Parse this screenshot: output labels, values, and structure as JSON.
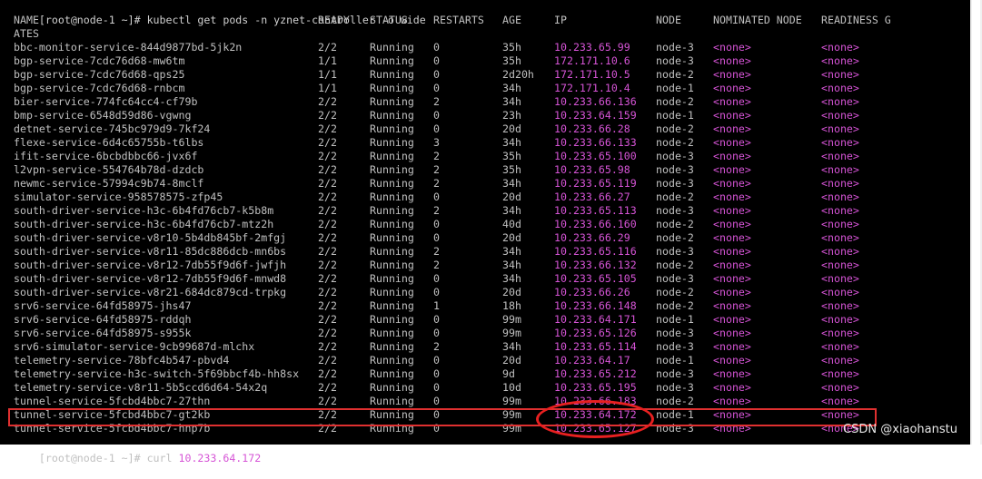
{
  "terminal": {
    "prompt_line": "[root@node-1 ~]# kubectl get pods -n yznet-controller -o wide",
    "headers": {
      "name": "NAME",
      "ready": "READY",
      "status": "STATUS",
      "restarts": "RESTARTS",
      "age": "AGE",
      "ip": "IP",
      "node": "NODE",
      "nominated_node": "NOMINATED NODE",
      "readiness_gates": "READINESS G",
      "wrap": "ATES"
    },
    "rows": [
      {
        "name": "bbc-monitor-service-844d9877bd-5jk2n",
        "ready": "2/2",
        "status": "Running",
        "restarts": "0",
        "age": "35h",
        "ip": "10.233.65.99",
        "node": "node-3",
        "nominated": "<none>",
        "gates": "<none>"
      },
      {
        "name": "bgp-service-7cdc76d68-mw6tm",
        "ready": "1/1",
        "status": "Running",
        "restarts": "0",
        "age": "35h",
        "ip": "172.171.10.6",
        "node": "node-3",
        "nominated": "<none>",
        "gates": "<none>"
      },
      {
        "name": "bgp-service-7cdc76d68-qps25",
        "ready": "1/1",
        "status": "Running",
        "restarts": "0",
        "age": "2d20h",
        "ip": "172.171.10.5",
        "node": "node-2",
        "nominated": "<none>",
        "gates": "<none>"
      },
      {
        "name": "bgp-service-7cdc76d68-rnbcm",
        "ready": "1/1",
        "status": "Running",
        "restarts": "0",
        "age": "34h",
        "ip": "172.171.10.4",
        "node": "node-1",
        "nominated": "<none>",
        "gates": "<none>"
      },
      {
        "name": "bier-service-774fc64cc4-cf79b",
        "ready": "2/2",
        "status": "Running",
        "restarts": "2",
        "age": "34h",
        "ip": "10.233.66.136",
        "node": "node-2",
        "nominated": "<none>",
        "gates": "<none>"
      },
      {
        "name": "bmp-service-6548d59d86-vgwng",
        "ready": "2/2",
        "status": "Running",
        "restarts": "0",
        "age": "23h",
        "ip": "10.233.64.159",
        "node": "node-1",
        "nominated": "<none>",
        "gates": "<none>"
      },
      {
        "name": "detnet-service-745bc979d9-7kf24",
        "ready": "2/2",
        "status": "Running",
        "restarts": "0",
        "age": "20d",
        "ip": "10.233.66.28",
        "node": "node-2",
        "nominated": "<none>",
        "gates": "<none>"
      },
      {
        "name": "flexe-service-6d4c65755b-t6lbs",
        "ready": "2/2",
        "status": "Running",
        "restarts": "3",
        "age": "34h",
        "ip": "10.233.66.133",
        "node": "node-2",
        "nominated": "<none>",
        "gates": "<none>"
      },
      {
        "name": "ifit-service-6bcbdbbc66-jvx6f",
        "ready": "2/2",
        "status": "Running",
        "restarts": "2",
        "age": "35h",
        "ip": "10.233.65.100",
        "node": "node-3",
        "nominated": "<none>",
        "gates": "<none>"
      },
      {
        "name": "l2vpn-service-554764b78d-dzdcb",
        "ready": "2/2",
        "status": "Running",
        "restarts": "2",
        "age": "35h",
        "ip": "10.233.65.98",
        "node": "node-3",
        "nominated": "<none>",
        "gates": "<none>"
      },
      {
        "name": "newmc-service-57994c9b74-8mclf",
        "ready": "2/2",
        "status": "Running",
        "restarts": "2",
        "age": "34h",
        "ip": "10.233.65.119",
        "node": "node-3",
        "nominated": "<none>",
        "gates": "<none>"
      },
      {
        "name": "simulator-service-958578575-zfp45",
        "ready": "2/2",
        "status": "Running",
        "restarts": "0",
        "age": "20d",
        "ip": "10.233.66.27",
        "node": "node-2",
        "nominated": "<none>",
        "gates": "<none>"
      },
      {
        "name": "south-driver-service-h3c-6b4fd76cb7-k5b8m",
        "ready": "2/2",
        "status": "Running",
        "restarts": "2",
        "age": "34h",
        "ip": "10.233.65.113",
        "node": "node-3",
        "nominated": "<none>",
        "gates": "<none>"
      },
      {
        "name": "south-driver-service-h3c-6b4fd76cb7-mtz2h",
        "ready": "2/2",
        "status": "Running",
        "restarts": "0",
        "age": "40d",
        "ip": "10.233.66.160",
        "node": "node-2",
        "nominated": "<none>",
        "gates": "<none>"
      },
      {
        "name": "south-driver-service-v8r10-5b4db845bf-2mfgj",
        "ready": "2/2",
        "status": "Running",
        "restarts": "0",
        "age": "20d",
        "ip": "10.233.66.29",
        "node": "node-2",
        "nominated": "<none>",
        "gates": "<none>"
      },
      {
        "name": "south-driver-service-v8r11-85dc886dcb-mn6bs",
        "ready": "2/2",
        "status": "Running",
        "restarts": "2",
        "age": "34h",
        "ip": "10.233.65.116",
        "node": "node-3",
        "nominated": "<none>",
        "gates": "<none>"
      },
      {
        "name": "south-driver-service-v8r12-7db55f9d6f-jwfjh",
        "ready": "2/2",
        "status": "Running",
        "restarts": "2",
        "age": "34h",
        "ip": "10.233.66.132",
        "node": "node-2",
        "nominated": "<none>",
        "gates": "<none>"
      },
      {
        "name": "south-driver-service-v8r12-7db55f9d6f-mnwd8",
        "ready": "2/2",
        "status": "Running",
        "restarts": "0",
        "age": "34h",
        "ip": "10.233.65.105",
        "node": "node-3",
        "nominated": "<none>",
        "gates": "<none>"
      },
      {
        "name": "south-driver-service-v8r21-684dc879cd-trpkg",
        "ready": "2/2",
        "status": "Running",
        "restarts": "0",
        "age": "20d",
        "ip": "10.233.66.26",
        "node": "node-2",
        "nominated": "<none>",
        "gates": "<none>"
      },
      {
        "name": "srv6-service-64fd58975-jhs47",
        "ready": "2/2",
        "status": "Running",
        "restarts": "1",
        "age": "18h",
        "ip": "10.233.66.148",
        "node": "node-2",
        "nominated": "<none>",
        "gates": "<none>"
      },
      {
        "name": "srv6-service-64fd58975-rddqh",
        "ready": "2/2",
        "status": "Running",
        "restarts": "0",
        "age": "99m",
        "ip": "10.233.64.171",
        "node": "node-1",
        "nominated": "<none>",
        "gates": "<none>"
      },
      {
        "name": "srv6-service-64fd58975-s955k",
        "ready": "2/2",
        "status": "Running",
        "restarts": "0",
        "age": "99m",
        "ip": "10.233.65.126",
        "node": "node-3",
        "nominated": "<none>",
        "gates": "<none>"
      },
      {
        "name": "srv6-simulator-service-9cb99687d-mlchx",
        "ready": "2/2",
        "status": "Running",
        "restarts": "2",
        "age": "34h",
        "ip": "10.233.65.114",
        "node": "node-3",
        "nominated": "<none>",
        "gates": "<none>"
      },
      {
        "name": "telemetry-service-78bfc4b547-pbvd4",
        "ready": "2/2",
        "status": "Running",
        "restarts": "0",
        "age": "20d",
        "ip": "10.233.64.17",
        "node": "node-1",
        "nominated": "<none>",
        "gates": "<none>"
      },
      {
        "name": "telemetry-service-h3c-switch-5f69bbcf4b-hh8sx",
        "ready": "2/2",
        "status": "Running",
        "restarts": "0",
        "age": "9d",
        "ip": "10.233.65.212",
        "node": "node-3",
        "nominated": "<none>",
        "gates": "<none>"
      },
      {
        "name": "telemetry-service-v8r11-5b5ccd6d64-54x2q",
        "ready": "2/2",
        "status": "Running",
        "restarts": "0",
        "age": "10d",
        "ip": "10.233.65.195",
        "node": "node-3",
        "nominated": "<none>",
        "gates": "<none>"
      },
      {
        "name": "tunnel-service-5fcbd4bbc7-27thn",
        "ready": "2/2",
        "status": "Running",
        "restarts": "0",
        "age": "99m",
        "ip": "10.233.66.183",
        "node": "node-2",
        "nominated": "<none>",
        "gates": "<none>"
      },
      {
        "name": "tunnel-service-5fcbd4bbc7-gt2kb",
        "ready": "2/2",
        "status": "Running",
        "restarts": "0",
        "age": "99m",
        "ip": "10.233.64.172",
        "node": "node-1",
        "nominated": "<none>",
        "gates": "<none>"
      },
      {
        "name": "tunnel-service-5fcbd4bbc7-hnp7b",
        "ready": "2/2",
        "status": "Running",
        "restarts": "0",
        "age": "99m",
        "ip": "10.233.65.127",
        "node": "node-3",
        "nominated": "<none>",
        "gates": "<none>"
      }
    ],
    "last_command": {
      "prompt": "[root@node-1 ~]# curl ",
      "ip": "10.233.64.172"
    }
  },
  "annotations": {
    "highlight_color": "#e03030"
  },
  "watermark": "CSDN @xiaohanstu"
}
